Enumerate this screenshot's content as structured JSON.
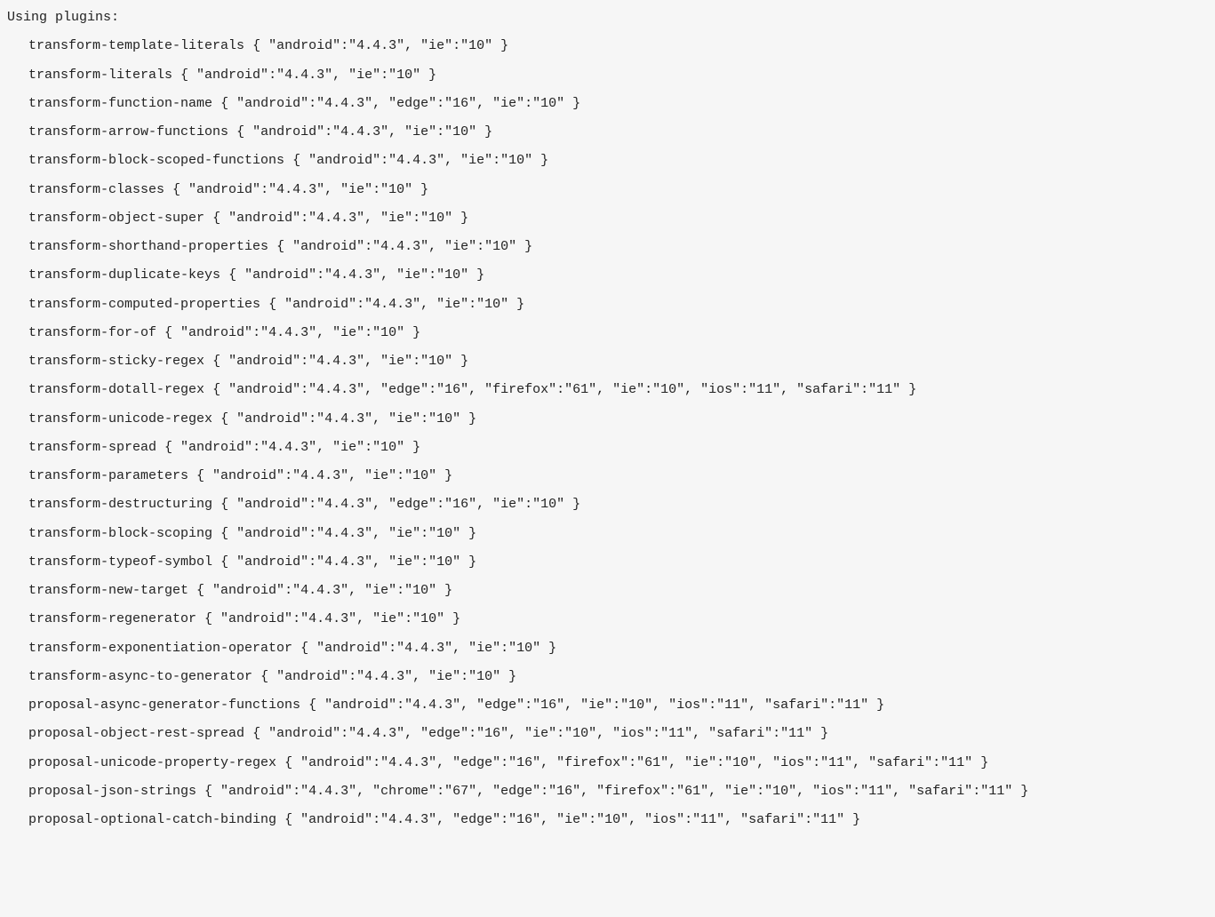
{
  "header": "Using plugins:",
  "plugins": [
    {
      "name": "transform-template-literals",
      "targets": "{ \"android\":\"4.4.3\", \"ie\":\"10\" }"
    },
    {
      "name": "transform-literals",
      "targets": "{ \"android\":\"4.4.3\", \"ie\":\"10\" }"
    },
    {
      "name": "transform-function-name",
      "targets": "{ \"android\":\"4.4.3\", \"edge\":\"16\", \"ie\":\"10\" }"
    },
    {
      "name": "transform-arrow-functions",
      "targets": "{ \"android\":\"4.4.3\", \"ie\":\"10\" }"
    },
    {
      "name": "transform-block-scoped-functions",
      "targets": "{ \"android\":\"4.4.3\", \"ie\":\"10\" }"
    },
    {
      "name": "transform-classes",
      "targets": "{ \"android\":\"4.4.3\", \"ie\":\"10\" }"
    },
    {
      "name": "transform-object-super",
      "targets": "{ \"android\":\"4.4.3\", \"ie\":\"10\" }"
    },
    {
      "name": "transform-shorthand-properties",
      "targets": "{ \"android\":\"4.4.3\", \"ie\":\"10\" }"
    },
    {
      "name": "transform-duplicate-keys",
      "targets": "{ \"android\":\"4.4.3\", \"ie\":\"10\" }"
    },
    {
      "name": "transform-computed-properties",
      "targets": "{ \"android\":\"4.4.3\", \"ie\":\"10\" }"
    },
    {
      "name": "transform-for-of",
      "targets": "{ \"android\":\"4.4.3\", \"ie\":\"10\" }"
    },
    {
      "name": "transform-sticky-regex",
      "targets": "{ \"android\":\"4.4.3\", \"ie\":\"10\" }"
    },
    {
      "name": "transform-dotall-regex",
      "targets": "{ \"android\":\"4.4.3\", \"edge\":\"16\", \"firefox\":\"61\", \"ie\":\"10\", \"ios\":\"11\", \"safari\":\"11\" }"
    },
    {
      "name": "transform-unicode-regex",
      "targets": "{ \"android\":\"4.4.3\", \"ie\":\"10\" }"
    },
    {
      "name": "transform-spread",
      "targets": "{ \"android\":\"4.4.3\", \"ie\":\"10\" }"
    },
    {
      "name": "transform-parameters",
      "targets": "{ \"android\":\"4.4.3\", \"ie\":\"10\" }"
    },
    {
      "name": "transform-destructuring",
      "targets": "{ \"android\":\"4.4.3\", \"edge\":\"16\", \"ie\":\"10\" }"
    },
    {
      "name": "transform-block-scoping",
      "targets": "{ \"android\":\"4.4.3\", \"ie\":\"10\" }"
    },
    {
      "name": "transform-typeof-symbol",
      "targets": "{ \"android\":\"4.4.3\", \"ie\":\"10\" }"
    },
    {
      "name": "transform-new-target",
      "targets": "{ \"android\":\"4.4.3\", \"ie\":\"10\" }"
    },
    {
      "name": "transform-regenerator",
      "targets": "{ \"android\":\"4.4.3\", \"ie\":\"10\" }"
    },
    {
      "name": "transform-exponentiation-operator",
      "targets": "{ \"android\":\"4.4.3\", \"ie\":\"10\" }"
    },
    {
      "name": "transform-async-to-generator",
      "targets": "{ \"android\":\"4.4.3\", \"ie\":\"10\" }"
    },
    {
      "name": "proposal-async-generator-functions",
      "targets": "{ \"android\":\"4.4.3\", \"edge\":\"16\", \"ie\":\"10\", \"ios\":\"11\", \"safari\":\"11\" }"
    },
    {
      "name": "proposal-object-rest-spread",
      "targets": "{ \"android\":\"4.4.3\", \"edge\":\"16\", \"ie\":\"10\", \"ios\":\"11\", \"safari\":\"11\" }"
    },
    {
      "name": "proposal-unicode-property-regex",
      "targets": "{ \"android\":\"4.4.3\", \"edge\":\"16\", \"firefox\":\"61\", \"ie\":\"10\", \"ios\":\"11\", \"safari\":\"11\" }"
    },
    {
      "name": "proposal-json-strings",
      "targets": "{ \"android\":\"4.4.3\", \"chrome\":\"67\", \"edge\":\"16\", \"firefox\":\"61\", \"ie\":\"10\", \"ios\":\"11\", \"safari\":\"11\" }"
    },
    {
      "name": "proposal-optional-catch-binding",
      "targets": "{ \"android\":\"4.4.3\", \"edge\":\"16\", \"ie\":\"10\", \"ios\":\"11\", \"safari\":\"11\" }"
    }
  ]
}
